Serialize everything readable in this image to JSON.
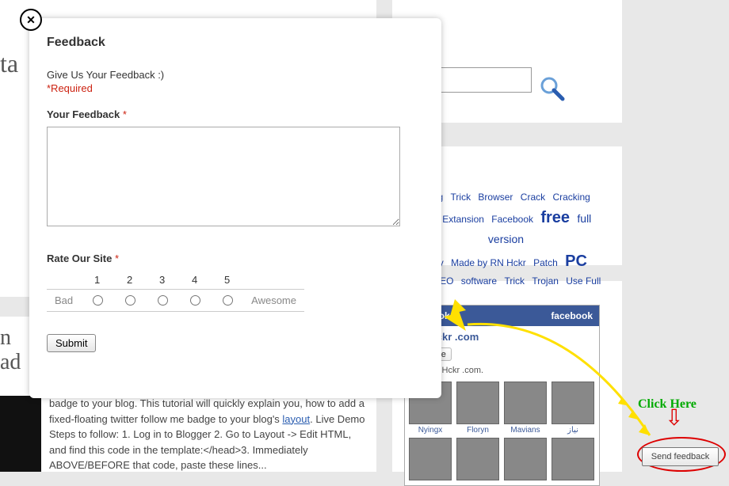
{
  "modal": {
    "title": "Feedback",
    "desc": "Give Us Your Feedback :)",
    "required": "*Required",
    "feedback_label": "Your Feedback",
    "rate_label": "Rate Our Site",
    "rate_numbers": [
      "1",
      "2",
      "3",
      "4",
      "5"
    ],
    "rate_bad": "Bad",
    "rate_awesome": "Awesome",
    "submit": "Submit",
    "close_icon": "✕"
  },
  "search": {
    "placeholder": ""
  },
  "tags": {
    "row1": [
      "Blog",
      "Trick",
      "Browser",
      "Crack",
      "Cracking"
    ],
    "row2_prefix": "d",
    "row2": [
      "Extansion",
      "Facebook"
    ],
    "row2_free": "free",
    "row2_full": "full version",
    "row3_prefix": "Key",
    "row3_mid": "Made by RN Hckr",
    "row3_patch": "Patch",
    "row3_pc": "PC",
    "row4_prefix": "rity",
    "row4": [
      "SEO",
      "software",
      "Trick",
      "Trojan",
      "Use Full"
    ]
  },
  "fb": {
    "header_left": "acebook",
    "header_right": "facebook",
    "page_title": "RN Hckr .com",
    "like_label": "Like",
    "likes_line": "like RN Hckr .com.",
    "people": [
      "Nyingx",
      "Floryn",
      "Mavians",
      "نیاز"
    ]
  },
  "article": {
    "body1": "badge to your blog. This tutorial will quickly explain you, how to add a fixed-floating twitter follow me badge to your blog's ",
    "link": "layout",
    "body2": ". Live Demo Steps to follow: 1. Log in to Blogger 2. Go to Layout -> Edit HTML, and find this code in the template:</head>3. Immediately ABOVE/BEFORE that code, paste these lines..."
  },
  "bg_title1": "ta",
  "bg_title2_line1": "n",
  "bg_title2_line2": "ad",
  "annotations": {
    "click_here": "Click Here",
    "send_feedback": "Send feedback"
  }
}
